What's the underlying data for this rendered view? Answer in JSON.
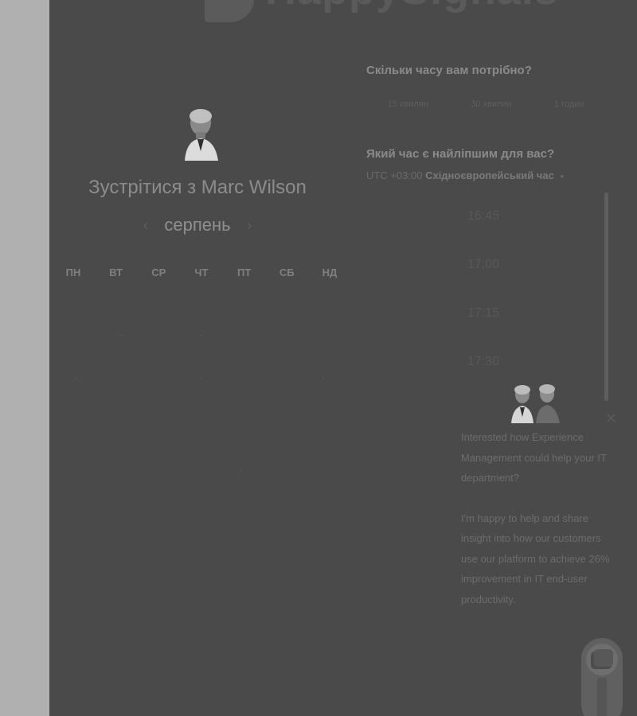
{
  "brand": {
    "logo_text": "HappySignals"
  },
  "booking": {
    "title": "Зустрітися з Marc Wilson",
    "calendar": {
      "month": "серпень",
      "prev_icon": "chevron-left-icon",
      "next_icon": "chevron-right-icon",
      "weekdays": [
        "ПН",
        "ВТ",
        "СР",
        "ЧТ",
        "ПТ",
        "СБ",
        "НД"
      ]
    },
    "duration": {
      "question": "Скільки часу вам потрібно?",
      "options": [
        "15 хвилин",
        "30 хвилин",
        "1 годин"
      ]
    },
    "time": {
      "question": "Який час є найліпшим для вас?",
      "timezone_offset": "UTC +03:00",
      "timezone_name": "Східноєвропейський час",
      "slots": [
        "16:45",
        "17:00",
        "17:15",
        "17:30"
      ]
    }
  },
  "chat": {
    "message_1": "Interested how Experience Management could help your IT department?",
    "message_2": "I'm happy to help and share insight into how our customers use our platform to achieve 26% improvement in IT end-user productivity.",
    "close_icon": "close-icon",
    "launcher_icon": "chat-icon"
  },
  "colors": {
    "overlay": "#4a4a4a",
    "backdrop": "#b0b0b0"
  }
}
